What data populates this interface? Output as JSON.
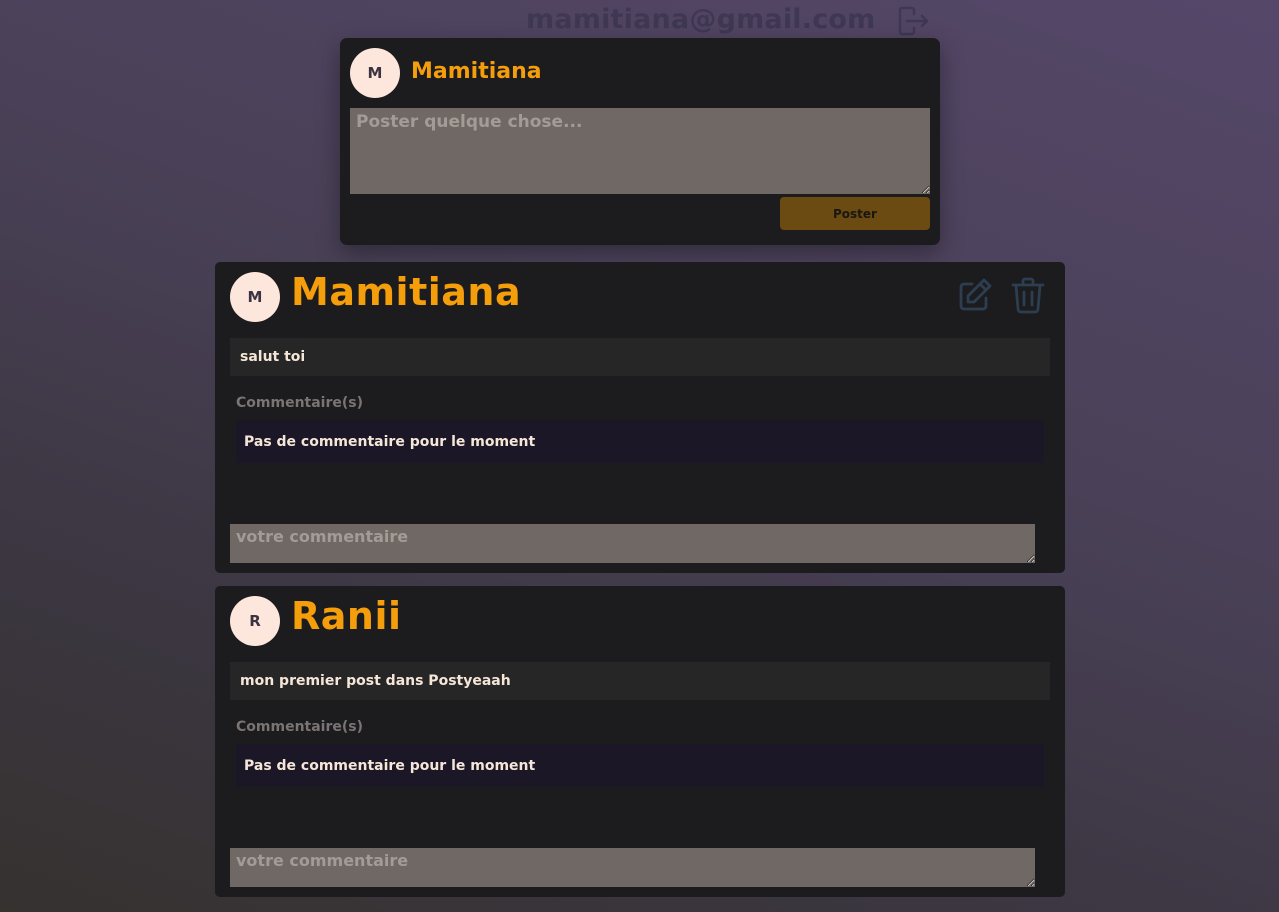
{
  "header": {
    "email": "mamitiana@gmail.com",
    "logout_icon": "logout-icon"
  },
  "composer": {
    "avatar_initial": "M",
    "name": "Mamitiana",
    "placeholder": "Poster quelque chose...",
    "value": "",
    "post_button": "Poster"
  },
  "posts": [
    {
      "avatar_initial": "M",
      "author": "Mamitiana",
      "content": "salut toi",
      "comments_title": "Commentaire(s)",
      "no_comments": "Pas de commentaire pour le moment",
      "comment_placeholder": "votre commentaire",
      "edit_icon": "edit-icon",
      "delete_icon": "trash-icon"
    },
    {
      "avatar_initial": "R",
      "author": "Ranii",
      "content": "mon premier post dans Postyeaah",
      "comments_title": "Commentaire(s)",
      "no_comments": "Pas de commentaire pour le moment",
      "comment_placeholder": "votre commentaire"
    }
  ],
  "colors": {
    "accent": "#f59e0b",
    "card": "#1c1b1e",
    "icon": "#2c3e50"
  }
}
